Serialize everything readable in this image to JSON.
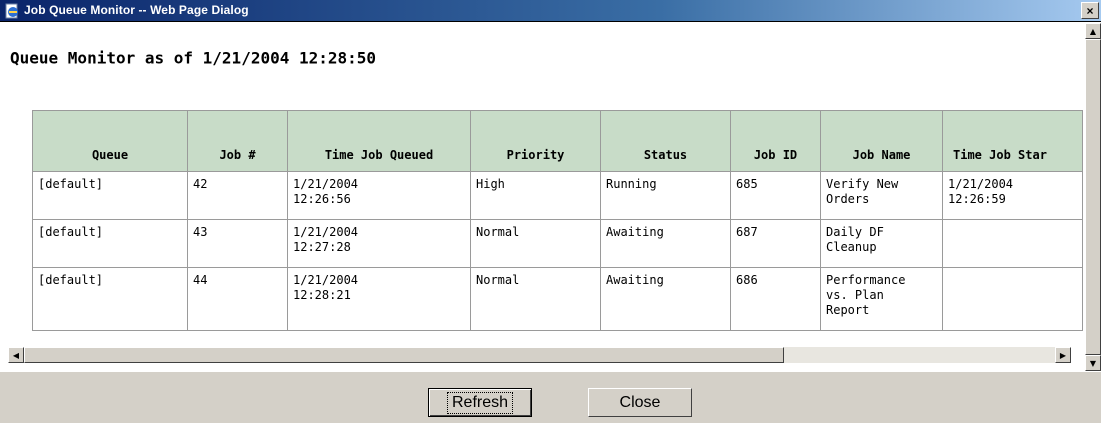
{
  "window": {
    "title": "Job Queue Monitor -- Web Page Dialog",
    "close_glyph": "×"
  },
  "page": {
    "heading": "Queue Monitor as of 1/21/2004 12:28:50"
  },
  "table": {
    "headers": [
      "Queue",
      "Job #",
      "Time Job Queued",
      "Priority",
      "Status",
      "Job ID",
      "Job Name",
      "Time Job Star"
    ],
    "rows": [
      {
        "queue": "[default]",
        "job_num": "42",
        "time_queued_date": "1/21/2004",
        "time_queued_time": "12:26:56",
        "priority": "High",
        "status": "Running",
        "job_id": "685",
        "job_name": [
          "Verify New",
          "Orders"
        ],
        "time_started_date": "1/21/2004",
        "time_started_time": "12:26:59"
      },
      {
        "queue": "[default]",
        "job_num": "43",
        "time_queued_date": "1/21/2004",
        "time_queued_time": "12:27:28",
        "priority": "Normal",
        "status": "Awaiting",
        "job_id": "687",
        "job_name": [
          "Daily DF",
          "Cleanup"
        ],
        "time_started_date": "",
        "time_started_time": ""
      },
      {
        "queue": "[default]",
        "job_num": "44",
        "time_queued_date": "1/21/2004",
        "time_queued_time": "12:28:21",
        "priority": "Normal",
        "status": "Awaiting",
        "job_id": "686",
        "job_name": [
          "Performance",
          "vs. Plan",
          "Report"
        ],
        "time_started_date": "",
        "time_started_time": ""
      }
    ]
  },
  "footer": {
    "refresh_label": "Refresh",
    "close_label": "Close"
  },
  "colors": {
    "header_bg": "#c8dcc8",
    "titlebar_start": "#0a246a",
    "dialog_face": "#d4d0c8"
  }
}
